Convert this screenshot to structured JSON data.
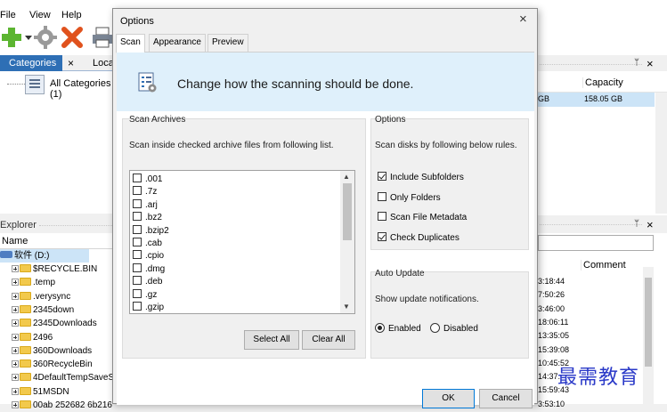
{
  "app": {
    "menu": [
      "File",
      "View",
      "Help"
    ],
    "left_tabs": {
      "active": "Categories",
      "close": "×",
      "other": "Loca"
    },
    "categories": {
      "root": "All Categories (1)"
    },
    "explorer": {
      "title": "Explorer",
      "column_name": "Name",
      "drive": "软件 (D:)",
      "folders": [
        "$RECYCLE.BIN",
        ".temp",
        ".verysync",
        "2345down",
        "2345Downloads",
        "2496",
        "360Downloads",
        "360RecycleBin",
        "4DefaultTempSaveSca",
        "51MSDN",
        "00ab 252682 6b216"
      ]
    },
    "right_panel": {
      "col_fragment": "Capacity",
      "row_fragment_left": "GB",
      "row_fragment_right": "158.05 GB",
      "comment_header": "Comment",
      "pin": "ᛘ",
      "close": "×",
      "times": [
        "3:18:44",
        "7:50:26",
        "3:46:00",
        "18:06:11",
        "13:35:05",
        "15:39:08",
        "10:45:52",
        "14:37:",
        "15:59:43",
        "3:53:10"
      ]
    },
    "watermark": "最需教育"
  },
  "dialog": {
    "title": "Options",
    "close": "×",
    "tabs": [
      "Scan",
      "Appearance",
      "Preview"
    ],
    "active_tab": "Scan",
    "banner": "Change how the scanning should be done.",
    "scan_archives": {
      "title": "Scan Archives",
      "description": "Scan inside checked archive files from following list.",
      "items": [
        ".001",
        ".7z",
        ".arj",
        ".bz2",
        ".bzip2",
        ".cab",
        ".cpio",
        ".dmg",
        ".deb",
        ".gz",
        ".gzip"
      ],
      "select_all": "Select All",
      "clear_all": "Clear All"
    },
    "options": {
      "title": "Options",
      "description": "Scan disks by following below rules.",
      "checkboxes": [
        {
          "label": "Include Subfolders",
          "checked": true
        },
        {
          "label": "Only Folders",
          "checked": false
        },
        {
          "label": "Scan File Metadata",
          "checked": false
        },
        {
          "label": "Check Duplicates",
          "checked": true
        }
      ]
    },
    "auto_update": {
      "title": "Auto Update",
      "description": "Show update notifications.",
      "enabled": "Enabled",
      "disabled": "Disabled",
      "selected": "Enabled"
    },
    "ok": "OK",
    "cancel": "Cancel"
  },
  "colors": {
    "accent": "#2e6fb5",
    "banner": "#dff0fb",
    "selection": "#cce4f7",
    "watermark": "#2a39c8"
  }
}
